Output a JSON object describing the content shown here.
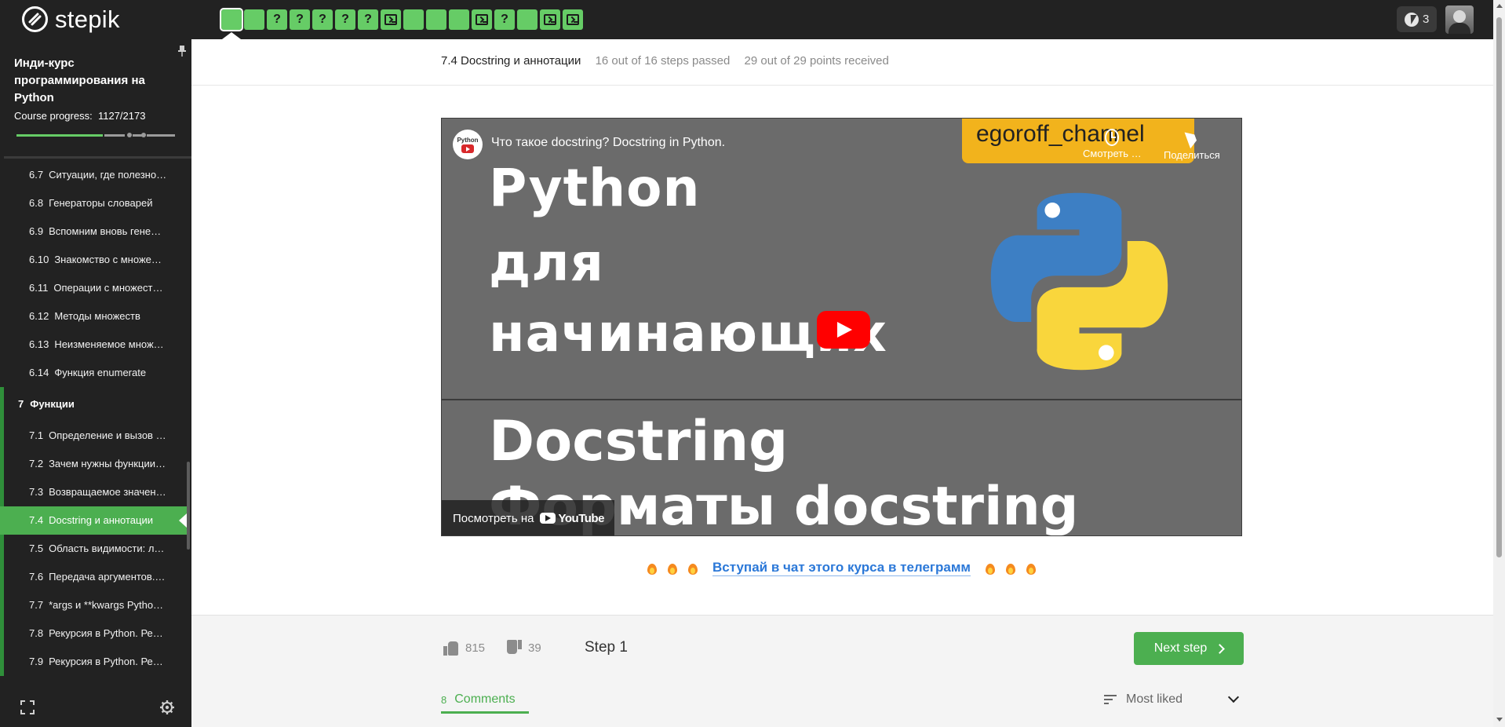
{
  "brand": {
    "name": "stepik"
  },
  "steps": [
    {
      "type": "video",
      "active": true
    },
    {
      "type": "text"
    },
    {
      "type": "quiz",
      "label": "?"
    },
    {
      "type": "quiz",
      "label": "?"
    },
    {
      "type": "quiz",
      "label": "?"
    },
    {
      "type": "quiz",
      "label": "?"
    },
    {
      "type": "quiz",
      "label": "?"
    },
    {
      "type": "code"
    },
    {
      "type": "text"
    },
    {
      "type": "text"
    },
    {
      "type": "text"
    },
    {
      "type": "code"
    },
    {
      "type": "quiz",
      "label": "?"
    },
    {
      "type": "text"
    },
    {
      "type": "code"
    },
    {
      "type": "code"
    }
  ],
  "header_right": {
    "energy_count": "3"
  },
  "sidebar": {
    "course_title": "Инди-курс программирования на Python",
    "progress_label": "Course progress:",
    "progress_value": "1127/2173",
    "progress_fraction": 0.52,
    "lessons_before": [
      {
        "num": "6.7",
        "title": "Ситуации, где полезно…"
      },
      {
        "num": "6.8",
        "title": "Генераторы словарей"
      },
      {
        "num": "6.9",
        "title": "Вспомним вновь гене…"
      },
      {
        "num": "6.10",
        "title": "Знакомство с множе…"
      },
      {
        "num": "6.11",
        "title": "Операции с множест…"
      },
      {
        "num": "6.12",
        "title": "Методы множеств"
      },
      {
        "num": "6.13",
        "title": "Неизменяемое множ…"
      },
      {
        "num": "6.14",
        "title": "Функция enumerate"
      }
    ],
    "section": {
      "num": "7",
      "title": "Функции"
    },
    "lessons_after": [
      {
        "num": "7.1",
        "title": "Определение и вызов …"
      },
      {
        "num": "7.2",
        "title": "Зачем нужны функции…"
      },
      {
        "num": "7.3",
        "title": "Возвращаемое значен…"
      },
      {
        "num": "7.4",
        "title": "Docstring и аннотации",
        "active": true
      },
      {
        "num": "7.5",
        "title": "Область видимости: л…"
      },
      {
        "num": "7.6",
        "title": "Передача аргументов.…"
      },
      {
        "num": "7.7",
        "title": "*args и **kwargs Pytho…"
      },
      {
        "num": "7.8",
        "title": "Рекурсия в Python. Ре…"
      },
      {
        "num": "7.9",
        "title": "Рекурсия в Python. Ре…"
      }
    ]
  },
  "lesson_header": {
    "title": "7.4 Docstring и аннотации",
    "steps_passed": "16 out of 16 steps passed",
    "points": "29 out of 29 points  received"
  },
  "video": {
    "channel_icon_text": "Python",
    "title": "Что такое docstring? Docstring in Python.",
    "channel_badge": "egoroff_channel",
    "watch_later": "Смотреть …",
    "share": "Поделиться",
    "thumb_line1": "Python",
    "thumb_line2": "для",
    "thumb_line3": "начинающих",
    "thumb_line4": "Docstring",
    "thumb_line5": "Форматы docstring",
    "watch_on": "Посмотреть на",
    "youtube": "YouTube"
  },
  "telegram": {
    "link_text": "Вступай в чат этого курса в телеграмм"
  },
  "footer": {
    "likes": "815",
    "dislikes": "39",
    "step_label": "Step 1",
    "next_step": "Next step",
    "comments_count": "8",
    "comments_label": "Comments",
    "sort_label": "Most liked"
  }
}
